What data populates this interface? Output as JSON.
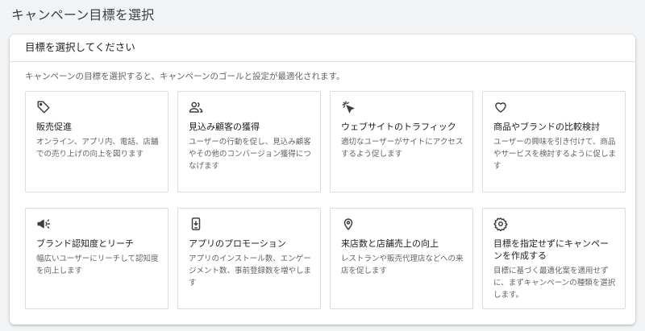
{
  "page": {
    "title": "キャンペーン目標を選択"
  },
  "panel": {
    "header": "目標を選択してください",
    "description": "キャンペーンの目標を選択すると、キャンペーンのゴールと設定が最適化されます。"
  },
  "goals": [
    {
      "icon": "tag-icon",
      "title": "販売促進",
      "description": "オンライン、アプリ内、電話、店舗での売り上げの向上を図ります"
    },
    {
      "icon": "people-icon",
      "title": "見込み顧客の獲得",
      "description": "ユーザーの行動を促し、見込み顧客やその他のコンバージョン獲得につなげます"
    },
    {
      "icon": "cursor-click-icon",
      "title": "ウェブサイトのトラフィック",
      "description": "適切なユーザーがサイトにアクセスするよう促します"
    },
    {
      "icon": "heart-icon",
      "title": "商品やブランドの比較検討",
      "description": "ユーザーの興味を引き付けて、商品やサービスを検討するように促します"
    },
    {
      "icon": "megaphone-icon",
      "title": "ブランド認知度とリーチ",
      "description": "幅広いユーザーにリーチして認知度を向上します"
    },
    {
      "icon": "phone-app-icon",
      "title": "アプリのプロモーション",
      "description": "アプリのインストール数、エンゲージメント数、事前登録数を増やします"
    },
    {
      "icon": "location-pin-icon",
      "title": "来店数と店舗売上の向上",
      "description": "レストランや販売代理店などへの来店を促します"
    },
    {
      "icon": "gear-icon",
      "title": "目標を指定せずにキャンペーンを作成する",
      "description": "目標に基づく最適化案を適用せずに、まずキャンペーンの種類を選択します。"
    }
  ]
}
